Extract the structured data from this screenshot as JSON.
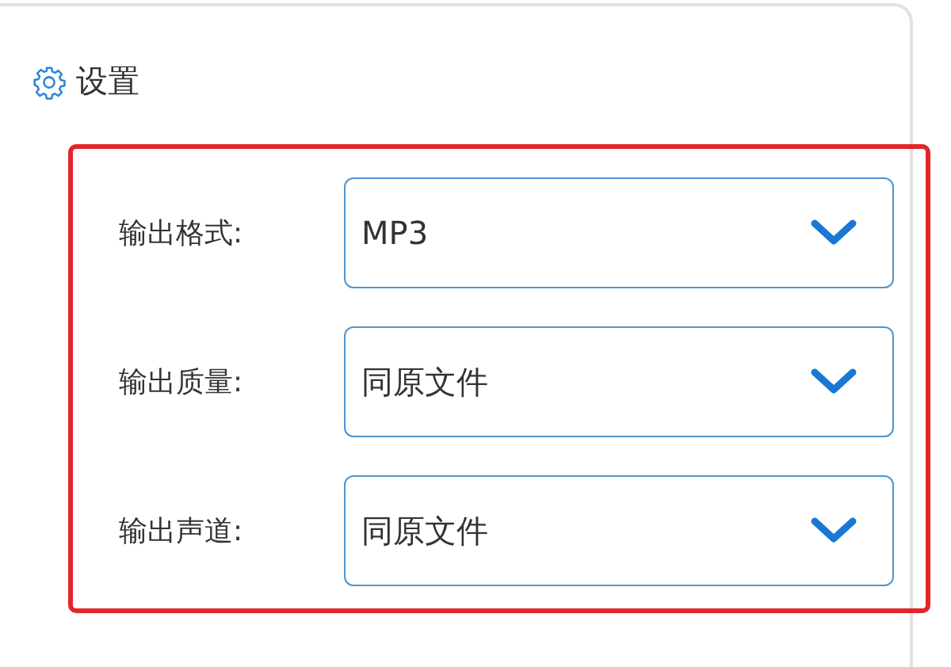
{
  "panel": {
    "title": "设置"
  },
  "fields": [
    {
      "label": "输出格式:",
      "value": "MP3"
    },
    {
      "label": "输出质量:",
      "value": "同原文件"
    },
    {
      "label": "输出声道:",
      "value": "同原文件"
    }
  ]
}
